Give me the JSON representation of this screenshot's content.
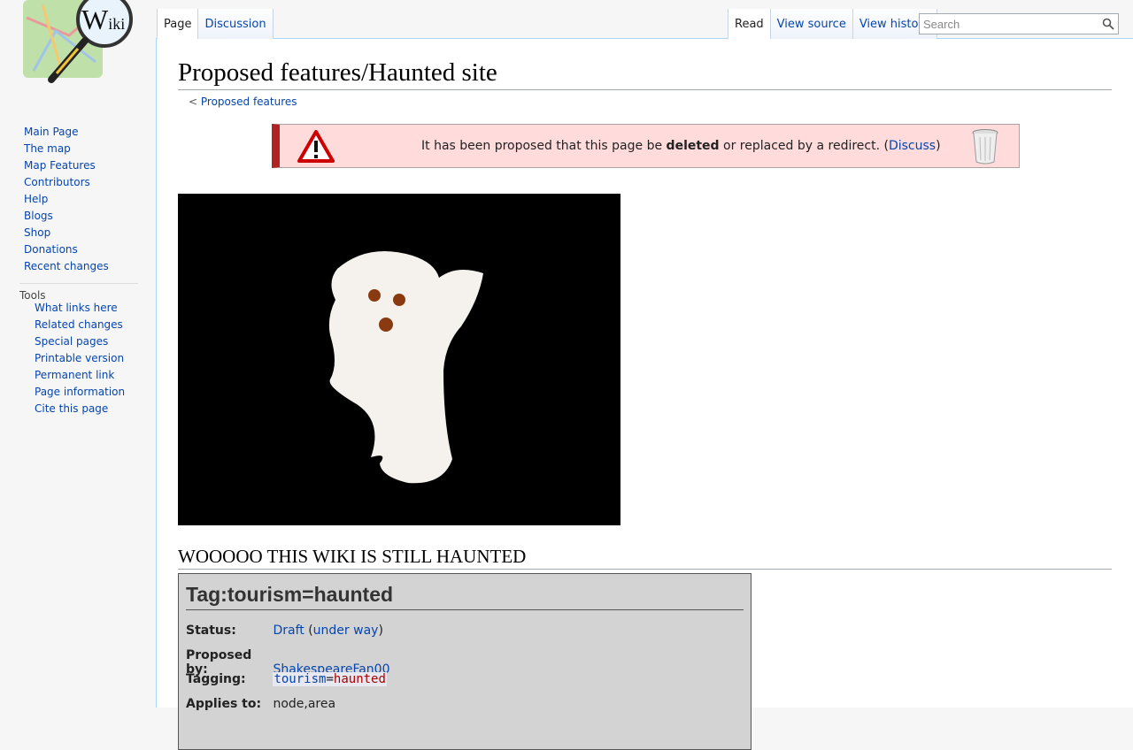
{
  "logo": {
    "text_main": "W",
    "text_small": "iki"
  },
  "sidebar": {
    "nav": [
      "Main Page",
      "The map",
      "Map Features",
      "Contributors",
      "Help",
      "Blogs",
      "Shop",
      "Donations",
      "Recent changes"
    ],
    "tools_heading": "Tools",
    "tools": [
      "What links here",
      "Related changes",
      "Special pages",
      "Printable version",
      "Permanent link",
      "Page information",
      "Cite this page"
    ]
  },
  "tabs": {
    "page": "Page",
    "discussion": "Discussion",
    "read": "Read",
    "view_source": "View source",
    "view_history": "View history"
  },
  "search": {
    "placeholder": "Search"
  },
  "page": {
    "title": "Proposed features/Haunted site",
    "subpage_prefix": "< ",
    "subpage_link": "Proposed features"
  },
  "notice": {
    "pre": "It has been proposed that this page be ",
    "bold": "deleted",
    "mid": " or replaced by a redirect. (",
    "link": "Discuss",
    "post": ")"
  },
  "section_heading": "WOOOOO THIS WIKI IS STILL HAUNTED",
  "infobox": {
    "title": "Tag:tourism=haunted",
    "status_label": "Status:",
    "status_value": "Draft",
    "status_paren_open": " (",
    "status_link": "under way",
    "status_paren_close": ")",
    "proposed_by_label": "Proposed by:",
    "proposed_by_value": "ShakespeareFan00",
    "tagging_label": "Tagging:",
    "tag_key": "tourism",
    "tag_eq": "=",
    "tag_value": "haunted",
    "applies_label": "Applies to:",
    "applies_value": "node,area"
  },
  "colors": {
    "link": "#0645ad",
    "notice_bg": "#ffdbdb",
    "notice_border": "#b22222",
    "infobox_bg": "#d3d3d3"
  }
}
